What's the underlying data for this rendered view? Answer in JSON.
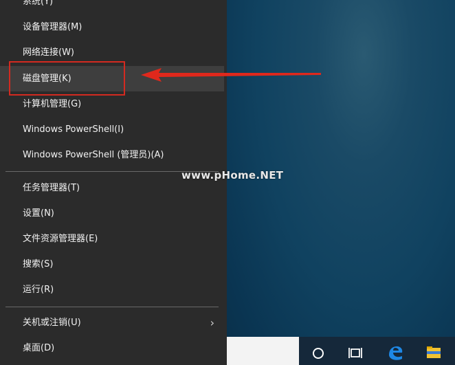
{
  "menu": {
    "items": [
      {
        "label": "系统(Y)"
      },
      {
        "label": "设备管理器(M)"
      },
      {
        "label": "网络连接(W)"
      },
      {
        "label": "磁盘管理(K)"
      },
      {
        "label": "计算机管理(G)"
      },
      {
        "label": "Windows PowerShell(I)"
      },
      {
        "label": "Windows PowerShell (管理员)(A)"
      },
      {
        "label": "任务管理器(T)"
      },
      {
        "label": "设置(N)"
      },
      {
        "label": "文件资源管理器(E)"
      },
      {
        "label": "搜索(S)"
      },
      {
        "label": "运行(R)"
      },
      {
        "label": "关机或注销(U)"
      },
      {
        "label": "桌面(D)"
      }
    ],
    "submenu_chevron": "›"
  },
  "annotation": {
    "highlighted_item": "磁盘管理(K)",
    "box_color": "#d42a20",
    "arrow_color": "#e0281c"
  },
  "watermark": "www.pHome.NET",
  "taskbar": {
    "icons": [
      "cortana-circle-icon",
      "task-view-icon",
      "edge-icon",
      "file-explorer-icon"
    ]
  }
}
